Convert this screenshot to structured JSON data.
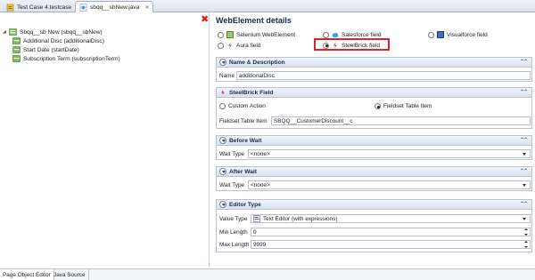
{
  "tabs": [
    {
      "label": "Test Case 4.testcase",
      "icon": "testcase-icon"
    },
    {
      "label": "sbqq__sbNew.java",
      "icon": "java-file-icon",
      "close": "✕"
    }
  ],
  "tree": {
    "root": {
      "label": "Sbqq__sb New (sbqq__sbNew)",
      "icon": "page-object-icon"
    },
    "children": [
      {
        "label": "Additional Disc (additionalDisc)",
        "icon": "element-icon",
        "selected": true
      },
      {
        "label": "Start Date (startDate)",
        "icon": "element-icon"
      },
      {
        "label": "Subscription Term (subscriptionTerm)",
        "icon": "element-icon"
      }
    ]
  },
  "bottom_tabs": [
    "Page Object Editor",
    "Java Source"
  ],
  "details": {
    "title": "WebElement details",
    "close_glyph": "✖",
    "types": {
      "selenium": "Selenium WebElement",
      "salesforce": "Salesforce field",
      "visualforce": "Visualforce field",
      "aura": "Aura field",
      "steelbrick": "SteelBrick field"
    },
    "selected_type": "SteelBrick field"
  },
  "sections": {
    "name_desc": {
      "title": "Name & Description",
      "name_label": "Name",
      "name_value": "additionalDisc"
    },
    "steelbrick": {
      "title": "SteelBrick Field",
      "custom_action": "Custom Action",
      "fieldset_item": "Fieldset Table Item",
      "fieldset_label": "Fieldset Table Item",
      "fieldset_value": "SBQQ__CustomerDiscount__c"
    },
    "before_wait": {
      "title": "Before Wait",
      "wait_label": "Wait Type",
      "wait_value": "<none>"
    },
    "after_wait": {
      "title": "After Wait",
      "wait_label": "Wait Type",
      "wait_value": "<none>"
    },
    "editor_type": {
      "title": "Editor Type",
      "value_type_label": "Value Type",
      "value_type_value": "Text Editor (with expressions)",
      "min_length_label": "Min Length",
      "min_length_value": "0",
      "max_length_label": "Max Length",
      "max_length_value": "9999"
    }
  },
  "collapse_glyph": "⌃⌃",
  "colors": {
    "accent_red": "#e02424",
    "header_blue": "#d9e2ef"
  }
}
